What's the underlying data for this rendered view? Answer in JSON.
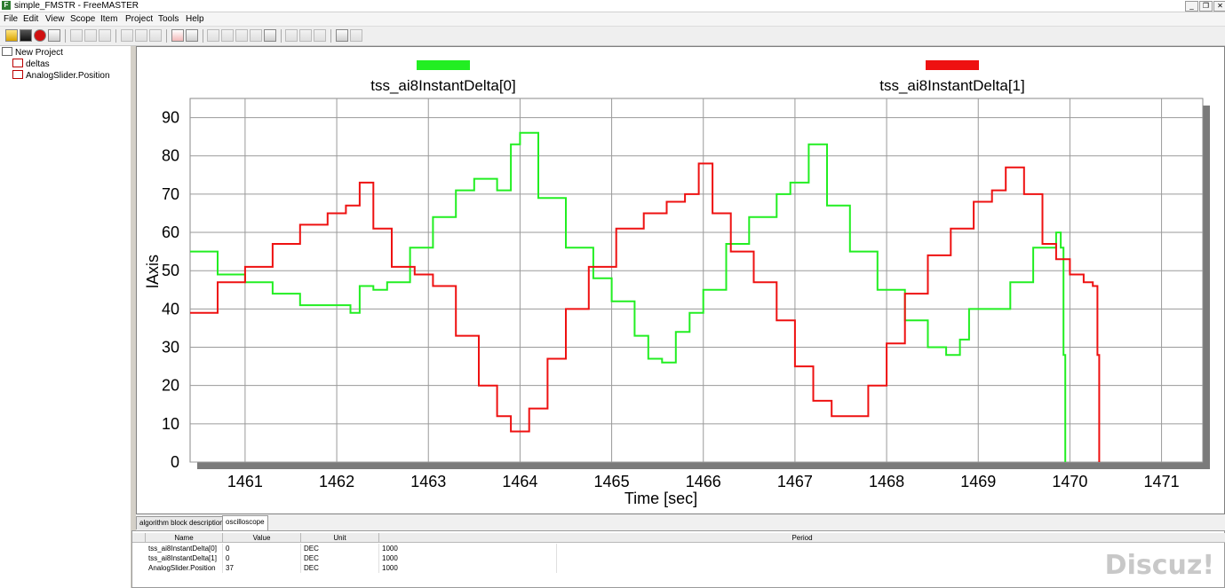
{
  "window": {
    "title": "simple_FMSTR - FreeMASTER"
  },
  "menu": [
    "File",
    "Edit",
    "View",
    "Scope",
    "Item",
    "Project",
    "Tools",
    "Help"
  ],
  "tree": {
    "root": "New Project",
    "children": [
      "deltas",
      "AnalogSlider.Position"
    ]
  },
  "tabs": [
    "algorithm block description",
    "oscilloscope"
  ],
  "watch": {
    "columns": [
      "Name",
      "Value",
      "Unit",
      "Period"
    ],
    "rows": [
      [
        "tss_ai8InstantDelta[0]",
        "0",
        "DEC",
        "1000"
      ],
      [
        "tss_ai8InstantDelta[1]",
        "0",
        "DEC",
        "1000"
      ],
      [
        "AnalogSlider.Position",
        "37",
        "DEC",
        "1000"
      ]
    ]
  },
  "watermark": "Discuz!",
  "chart_data": {
    "type": "line",
    "xlabel": "Time [sec]",
    "ylabel": "lAxis",
    "xlim": [
      1460.4,
      1471.45
    ],
    "ylim": [
      0,
      95
    ],
    "xticks": [
      1461,
      1462,
      1463,
      1464,
      1465,
      1466,
      1467,
      1468,
      1469,
      1470,
      1471
    ],
    "yticks": [
      0,
      10,
      20,
      30,
      40,
      50,
      60,
      70,
      80,
      90
    ],
    "grid": true,
    "legend_position": "top",
    "series": [
      {
        "name": "tss_ai8InstantDelta[0]",
        "color": "#22ee22",
        "points": [
          [
            1460.4,
            55
          ],
          [
            1460.7,
            49
          ],
          [
            1461.0,
            47
          ],
          [
            1461.3,
            44
          ],
          [
            1461.6,
            41
          ],
          [
            1461.9,
            41
          ],
          [
            1462.15,
            39
          ],
          [
            1462.25,
            46
          ],
          [
            1462.4,
            45
          ],
          [
            1462.55,
            47
          ],
          [
            1462.8,
            56
          ],
          [
            1463.05,
            64
          ],
          [
            1463.3,
            71
          ],
          [
            1463.5,
            74
          ],
          [
            1463.75,
            71
          ],
          [
            1463.9,
            83
          ],
          [
            1464.0,
            86
          ],
          [
            1464.2,
            69
          ],
          [
            1464.5,
            56
          ],
          [
            1464.8,
            48
          ],
          [
            1465.0,
            42
          ],
          [
            1465.25,
            33
          ],
          [
            1465.4,
            27
          ],
          [
            1465.55,
            26
          ],
          [
            1465.7,
            34
          ],
          [
            1465.85,
            39
          ],
          [
            1466.0,
            45
          ],
          [
            1466.25,
            57
          ],
          [
            1466.5,
            64
          ],
          [
            1466.8,
            70
          ],
          [
            1466.95,
            73
          ],
          [
            1467.15,
            83
          ],
          [
            1467.35,
            67
          ],
          [
            1467.6,
            55
          ],
          [
            1467.9,
            45
          ],
          [
            1468.2,
            37
          ],
          [
            1468.45,
            30
          ],
          [
            1468.65,
            28
          ],
          [
            1468.8,
            32
          ],
          [
            1468.9,
            40
          ],
          [
            1469.1,
            40
          ],
          [
            1469.35,
            47
          ],
          [
            1469.6,
            56
          ],
          [
            1469.85,
            60
          ],
          [
            1469.9,
            56
          ],
          [
            1469.93,
            28
          ],
          [
            1469.95,
            0
          ]
        ]
      },
      {
        "name": "tss_ai8InstantDelta[1]",
        "color": "#ee1111",
        "points": [
          [
            1460.4,
            39
          ],
          [
            1460.7,
            47
          ],
          [
            1461.0,
            51
          ],
          [
            1461.3,
            57
          ],
          [
            1461.6,
            62
          ],
          [
            1461.9,
            65
          ],
          [
            1462.1,
            67
          ],
          [
            1462.25,
            73
          ],
          [
            1462.4,
            61
          ],
          [
            1462.6,
            51
          ],
          [
            1462.85,
            49
          ],
          [
            1463.05,
            46
          ],
          [
            1463.3,
            33
          ],
          [
            1463.55,
            20
          ],
          [
            1463.75,
            12
          ],
          [
            1463.9,
            8
          ],
          [
            1464.1,
            14
          ],
          [
            1464.3,
            27
          ],
          [
            1464.5,
            40
          ],
          [
            1464.75,
            51
          ],
          [
            1465.05,
            61
          ],
          [
            1465.35,
            65
          ],
          [
            1465.6,
            68
          ],
          [
            1465.8,
            70
          ],
          [
            1465.95,
            78
          ],
          [
            1466.1,
            65
          ],
          [
            1466.3,
            55
          ],
          [
            1466.55,
            47
          ],
          [
            1466.8,
            37
          ],
          [
            1467.0,
            25
          ],
          [
            1467.2,
            16
          ],
          [
            1467.4,
            12
          ],
          [
            1467.6,
            12
          ],
          [
            1467.8,
            20
          ],
          [
            1468.0,
            31
          ],
          [
            1468.2,
            44
          ],
          [
            1468.45,
            54
          ],
          [
            1468.7,
            61
          ],
          [
            1468.95,
            68
          ],
          [
            1469.15,
            71
          ],
          [
            1469.3,
            77
          ],
          [
            1469.5,
            70
          ],
          [
            1469.7,
            57
          ],
          [
            1469.85,
            53
          ],
          [
            1470.0,
            49
          ],
          [
            1470.15,
            47
          ],
          [
            1470.25,
            46
          ],
          [
            1470.3,
            28
          ],
          [
            1470.32,
            0
          ]
        ]
      }
    ]
  }
}
